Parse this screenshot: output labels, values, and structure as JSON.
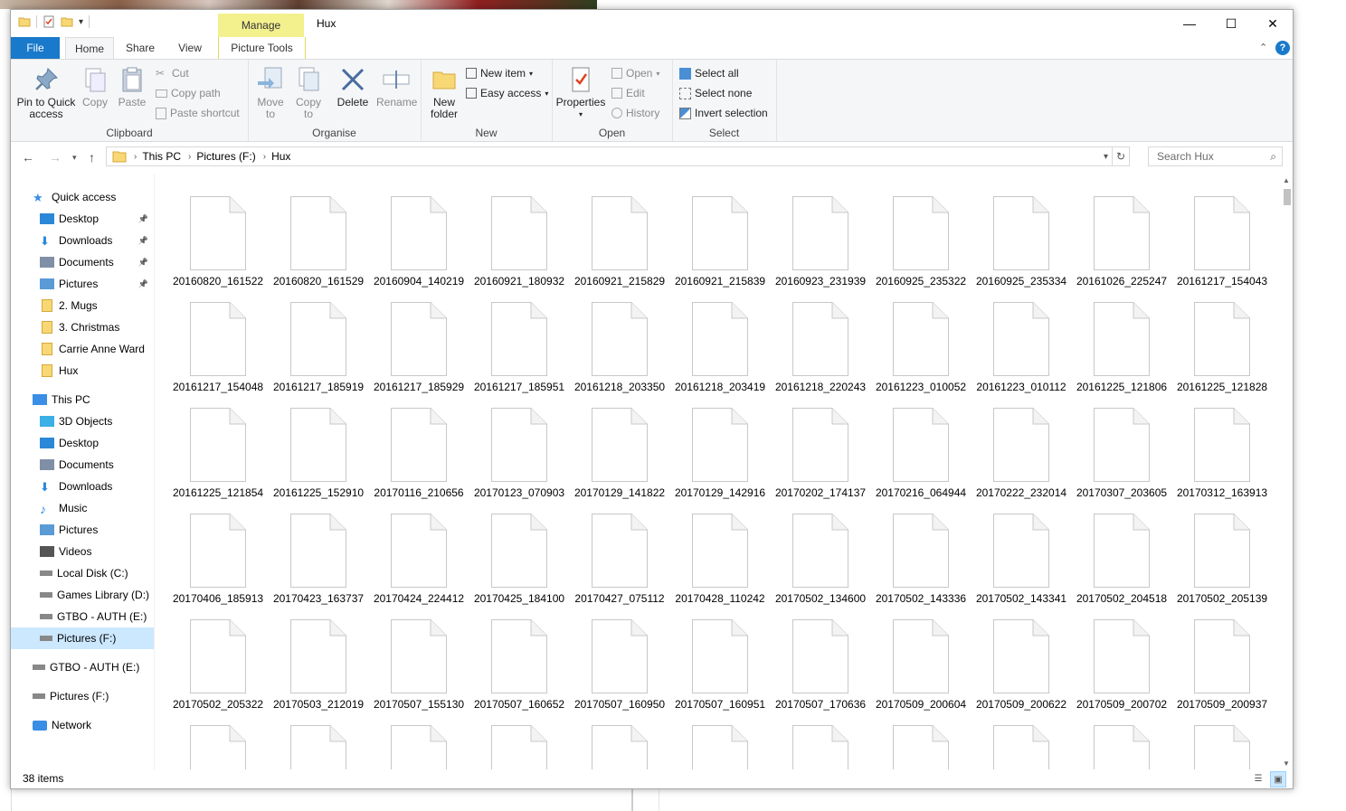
{
  "window": {
    "title": "Hux",
    "manage_label": "Manage",
    "minimize": "—",
    "maximize": "☐",
    "close": "✕"
  },
  "tabs": {
    "file": "File",
    "home": "Home",
    "share": "Share",
    "view": "View",
    "picture_tools": "Picture Tools"
  },
  "ribbon": {
    "clipboard": {
      "label": "Clipboard",
      "pin_line1": "Pin to Quick",
      "pin_line2": "access",
      "copy": "Copy",
      "paste": "Paste",
      "cut": "Cut",
      "copy_path": "Copy path",
      "paste_shortcut": "Paste shortcut"
    },
    "organise": {
      "label": "Organise",
      "move_line1": "Move",
      "move_line2": "to",
      "copy_line1": "Copy",
      "copy_line2": "to",
      "delete": "Delete",
      "rename": "Rename"
    },
    "new": {
      "label": "New",
      "folder_line1": "New",
      "folder_line2": "folder",
      "new_item": "New item",
      "easy_access": "Easy access"
    },
    "open": {
      "label": "Open",
      "properties": "Properties",
      "open": "Open",
      "edit": "Edit",
      "history": "History"
    },
    "select": {
      "label": "Select",
      "select_all": "Select all",
      "select_none": "Select none",
      "invert": "Invert selection"
    }
  },
  "address": {
    "crumbs": [
      "This PC",
      "Pictures (F:)",
      "Hux"
    ],
    "search_placeholder": "Search Hux"
  },
  "nav": [
    {
      "label": "Quick access",
      "icon": "star-icon",
      "indent": 0,
      "pinned": false
    },
    {
      "label": "Desktop",
      "icon": "desktop-icon",
      "indent": 1,
      "pinned": true
    },
    {
      "label": "Downloads",
      "icon": "download-icon",
      "indent": 1,
      "pinned": true
    },
    {
      "label": "Documents",
      "icon": "documents-icon",
      "indent": 1,
      "pinned": true
    },
    {
      "label": "Pictures",
      "icon": "pictures-icon",
      "indent": 1,
      "pinned": true
    },
    {
      "label": "2. Mugs",
      "icon": "folder-icon",
      "indent": 1,
      "pinned": false
    },
    {
      "label": "3. Christmas",
      "icon": "folder-icon",
      "indent": 1,
      "pinned": false
    },
    {
      "label": "Carrie Anne Ward",
      "icon": "folder-icon",
      "indent": 1,
      "pinned": false
    },
    {
      "label": "Hux",
      "icon": "folder-icon",
      "indent": 1,
      "pinned": false
    },
    {
      "label": "This PC",
      "icon": "pc-icon",
      "indent": 0,
      "pinned": false
    },
    {
      "label": "3D Objects",
      "icon": "3d-objects-icon",
      "indent": 1,
      "pinned": false
    },
    {
      "label": "Desktop",
      "icon": "desktop-icon",
      "indent": 1,
      "pinned": false
    },
    {
      "label": "Documents",
      "icon": "documents-icon",
      "indent": 1,
      "pinned": false
    },
    {
      "label": "Downloads",
      "icon": "download-icon",
      "indent": 1,
      "pinned": false
    },
    {
      "label": "Music",
      "icon": "music-icon",
      "indent": 1,
      "pinned": false
    },
    {
      "label": "Pictures",
      "icon": "pictures-icon",
      "indent": 1,
      "pinned": false
    },
    {
      "label": "Videos",
      "icon": "videos-icon",
      "indent": 1,
      "pinned": false
    },
    {
      "label": "Local Disk (C:)",
      "icon": "drive-icon",
      "indent": 1,
      "pinned": false
    },
    {
      "label": "Games Library (D:)",
      "icon": "drive-icon",
      "indent": 1,
      "pinned": false
    },
    {
      "label": "GTBO - AUTH (E:)",
      "icon": "drive-icon",
      "indent": 1,
      "pinned": false
    },
    {
      "label": "Pictures (F:)",
      "icon": "drive-icon",
      "indent": 1,
      "pinned": false,
      "selected": true
    },
    {
      "label": "GTBO - AUTH (E:)",
      "icon": "drive-icon",
      "indent": 0,
      "pinned": false
    },
    {
      "label": "Pictures (F:)",
      "icon": "drive-icon",
      "indent": 0,
      "pinned": false
    },
    {
      "label": "Network",
      "icon": "network-icon",
      "indent": 0,
      "pinned": false
    }
  ],
  "files": [
    "20160820_161522",
    "20160820_161529",
    "20160904_140219",
    "20160921_180932",
    "20160921_215829",
    "20160921_215839",
    "20160923_231939",
    "20160925_235322",
    "20160925_235334",
    "20161026_225247",
    "20161217_154043",
    "20161217_154048",
    "20161217_185919",
    "20161217_185929",
    "20161217_185951",
    "20161218_203350",
    "20161218_203419",
    "20161218_220243",
    "20161223_010052",
    "20161223_010112",
    "20161225_121806",
    "20161225_121828",
    "20161225_121854",
    "20161225_152910",
    "20170116_210656",
    "20170123_070903",
    "20170129_141822",
    "20170129_142916",
    "20170202_174137",
    "20170216_064944",
    "20170222_232014",
    "20170307_203605",
    "20170312_163913",
    "20170406_185913",
    "20170423_163737",
    "20170424_224412",
    "20170425_184100",
    "20170427_075112",
    "20170428_110242",
    "20170502_134600",
    "20170502_143336",
    "20170502_143341",
    "20170502_204518",
    "20170502_205139",
    "20170502_205322",
    "20170503_212019",
    "20170507_155130",
    "20170507_160652",
    "20170507_160950",
    "20170507_160951",
    "20170507_170636",
    "20170509_200604",
    "20170509_200622",
    "20170509_200702",
    "20170509_200937",
    "",
    "",
    "",
    "",
    "",
    "",
    "",
    "",
    "",
    "",
    ""
  ],
  "status": {
    "count": "38 items"
  }
}
